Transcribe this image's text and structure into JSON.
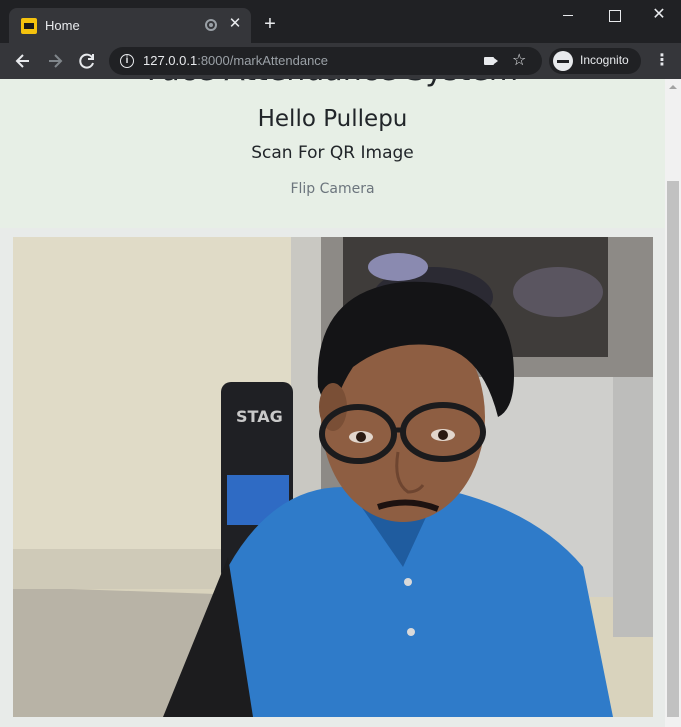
{
  "browser": {
    "tab": {
      "title": "Home"
    },
    "new_tab_glyph": "+",
    "close_glyph": "✕",
    "url_host": "127.0.0.1",
    "url_rest": ":8000/markAttendance",
    "incognito_label": "Incognito",
    "menu_glyph": "⋮",
    "icons": {
      "back": "arrow-left-icon",
      "forward": "arrow-right-icon",
      "reload": "reload-icon",
      "info": "info-icon",
      "camera": "camera-icon",
      "bookmark": "star-icon",
      "incognito": "incognito-icon"
    }
  },
  "page": {
    "heading": "Face Attendance System",
    "greeting": "Hello Pullepu",
    "scan_label": "Scan For QR Image",
    "flip_camera": "Flip Camera"
  },
  "colors": {
    "header_bg": "#e7efe6",
    "page_bg": "#e8ebe9",
    "text": "#212529",
    "muted_text": "#6c757d"
  }
}
